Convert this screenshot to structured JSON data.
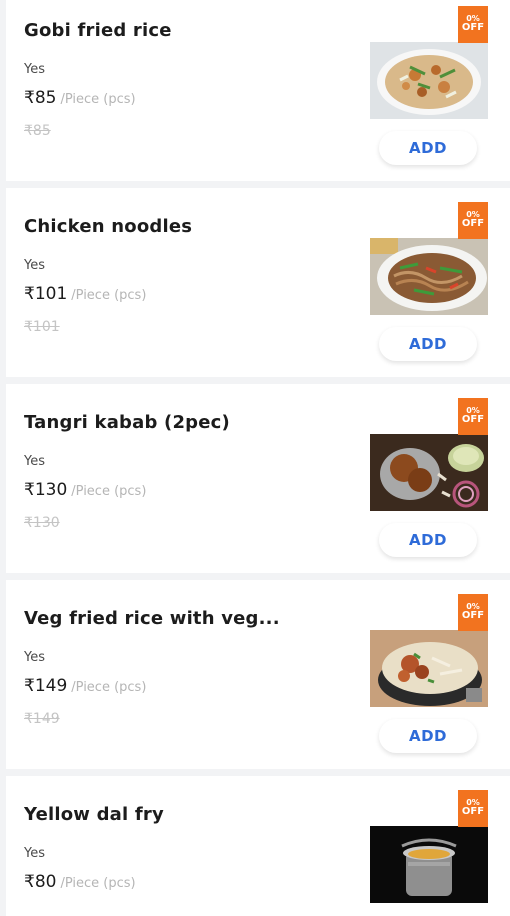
{
  "items": [
    {
      "name": "Gobi fried rice",
      "veg": "Yes",
      "price": "₹85",
      "unit": "/Piece (pcs)",
      "mrp": "₹85",
      "discount_pct": "0%",
      "discount_off": "OFF",
      "add_label": "ADD",
      "image": "gobi-fried-rice-image"
    },
    {
      "name": "Chicken noodles",
      "veg": "Yes",
      "price": "₹101",
      "unit": "/Piece (pcs)",
      "mrp": "₹101",
      "discount_pct": "0%",
      "discount_off": "OFF",
      "add_label": "ADD",
      "image": "chicken-noodles-image"
    },
    {
      "name": "Tangri kabab (2pec)",
      "veg": "Yes",
      "price": "₹130",
      "unit": "/Piece (pcs)",
      "mrp": "₹130",
      "discount_pct": "0%",
      "discount_off": "OFF",
      "add_label": "ADD",
      "image": "tangri-kabab-image"
    },
    {
      "name": "Veg fried rice with veg...",
      "veg": "Yes",
      "price": "₹149",
      "unit": "/Piece (pcs)",
      "mrp": "₹149",
      "discount_pct": "0%",
      "discount_off": "OFF",
      "add_label": "ADD",
      "image": "veg-fried-rice-image"
    },
    {
      "name": "Yellow dal fry",
      "veg": "Yes",
      "price": "₹80",
      "unit": "/Piece (pcs)",
      "mrp": "",
      "discount_pct": "0%",
      "discount_off": "OFF",
      "add_label": "",
      "image": "yellow-dal-fry-image"
    }
  ],
  "colors": {
    "badge": "#f2731f",
    "add_text": "#2e6bd8",
    "background": "#f2f3f5"
  }
}
